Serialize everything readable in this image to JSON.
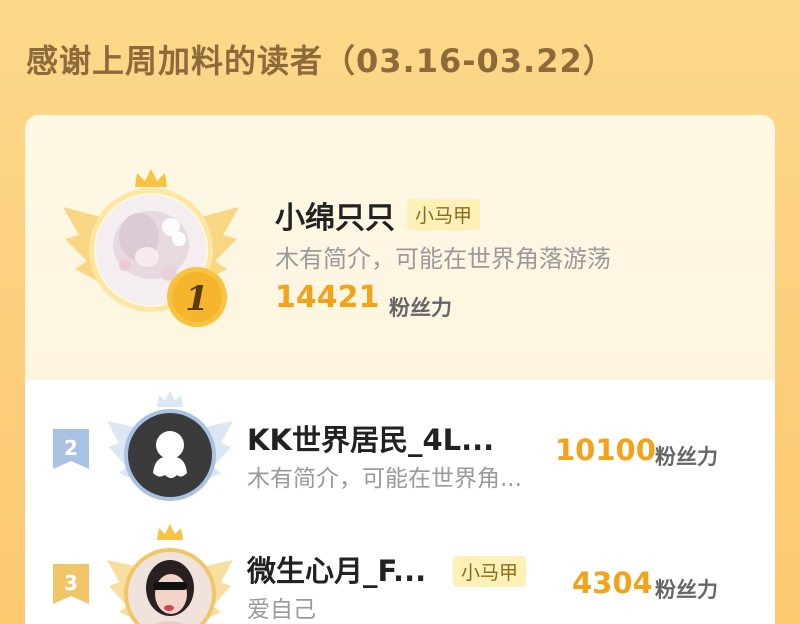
{
  "page": {
    "title": "感谢上周加料的读者（03.16-03.22）"
  },
  "top_reader": {
    "rank": "1",
    "name": "小绵只只",
    "badge": "小马甲",
    "intro": "木有简介，可能在世界角落游荡",
    "fans_value": "14421",
    "fans_label": "粉丝力",
    "avatar": "anime-girl-avatar",
    "crown": "crown-icon"
  },
  "readers": [
    {
      "rank": "2",
      "name": "KK世界居民_4L...",
      "badge": "",
      "intro": "木有简介，可能在世界角...",
      "fans_value": "10100",
      "fans_label": "粉丝力",
      "avatar": "default-ghost-avatar"
    },
    {
      "rank": "3",
      "name": "微生心月_F...",
      "badge": "小马甲",
      "intro": "爱自己",
      "fans_value": "4304",
      "fans_label": "粉丝力",
      "avatar": "photo-avatar"
    }
  ],
  "colors": {
    "accent": "#f4a21a",
    "gold": "#f7c340",
    "silver": "#a9c2e3",
    "bronze": "#f0c669",
    "title": "#8d6a3b"
  }
}
